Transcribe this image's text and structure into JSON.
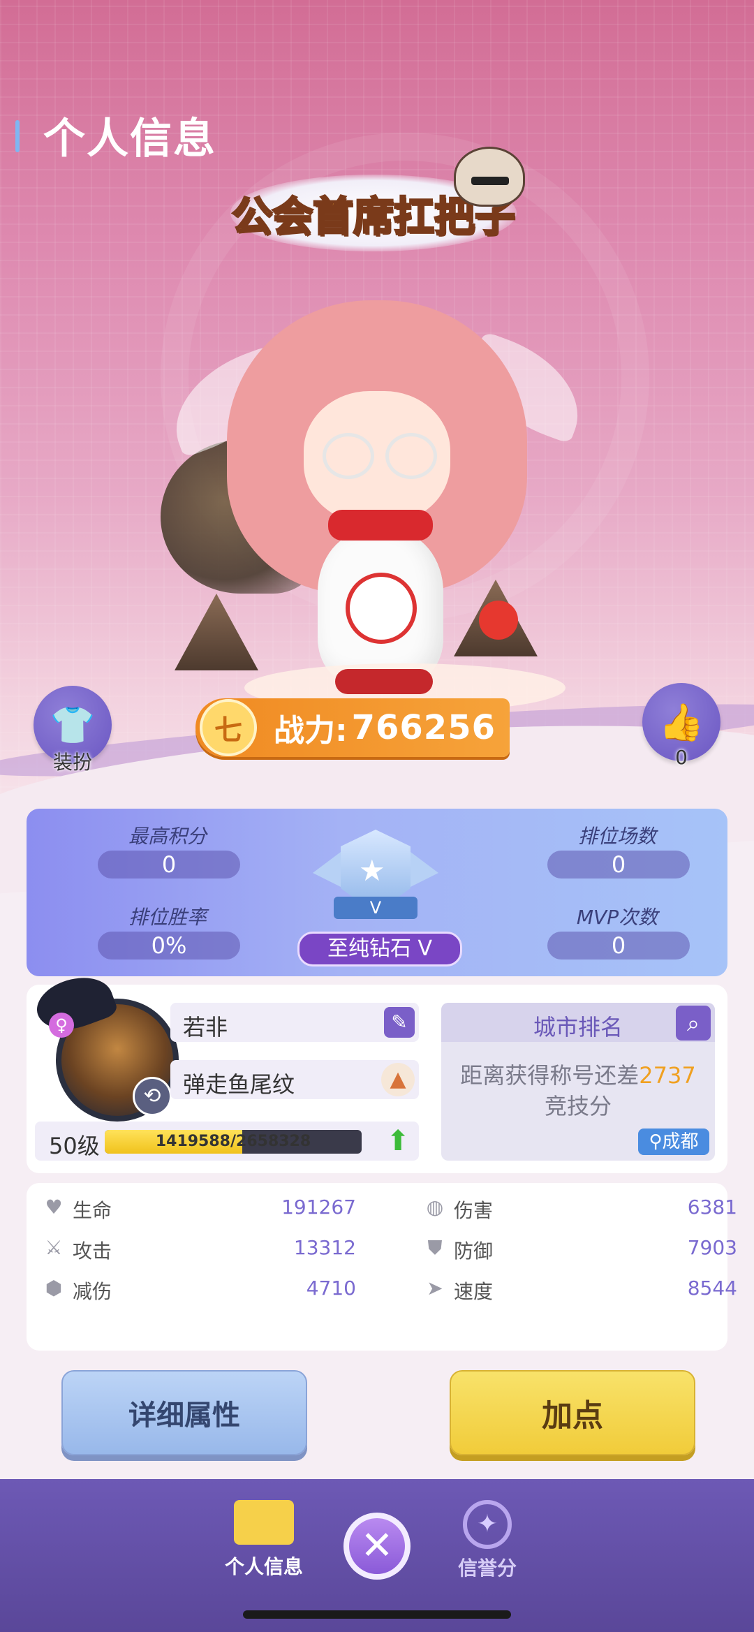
{
  "page": {
    "title": "个人信息"
  },
  "guild_title": "公会首席扛把子",
  "side_buttons": {
    "outfit_label": "装扮",
    "like_count": "0"
  },
  "power": {
    "label": "战力:",
    "value": "766256"
  },
  "rank": {
    "highest_score_label": "最高积分",
    "highest_score": "0",
    "ranked_matches_label": "排位场数",
    "ranked_matches": "0",
    "win_rate_label": "排位胜率",
    "win_rate": "0%",
    "mvp_label": "MVP次数",
    "mvp_count": "0",
    "tier_badge_text": "V",
    "tier_name": "至纯钻石 V"
  },
  "profile": {
    "name": "若非",
    "title": "弹走鱼尾纹",
    "level": "50级",
    "xp_text": "1419588/2658328",
    "xp_fraction": 0.534
  },
  "city": {
    "title": "城市排名",
    "desc_prefix": "距离获得称号还差",
    "desc_number": "2737",
    "desc_suffix": "竞技分",
    "location": "成都"
  },
  "attributes": [
    {
      "name": "生命",
      "value": "191267",
      "icon": "heart-icon"
    },
    {
      "name": "伤害",
      "value": "6381",
      "icon": "globe-damage-icon"
    },
    {
      "name": "攻击",
      "value": "13312",
      "icon": "sword-icon"
    },
    {
      "name": "防御",
      "value": "7903",
      "icon": "shield-icon"
    },
    {
      "name": "减伤",
      "value": "4710",
      "icon": "armor-icon"
    },
    {
      "name": "速度",
      "value": "8544",
      "icon": "boot-icon"
    }
  ],
  "buttons": {
    "detail": "详细属性",
    "add_points": "加点"
  },
  "tabbar": {
    "profile_label": "个人信息",
    "credit_label": "信誉分"
  },
  "colors": {
    "accent": "#7a5fc8",
    "power": "#f08a22",
    "add_button": "#f1cc3a"
  }
}
